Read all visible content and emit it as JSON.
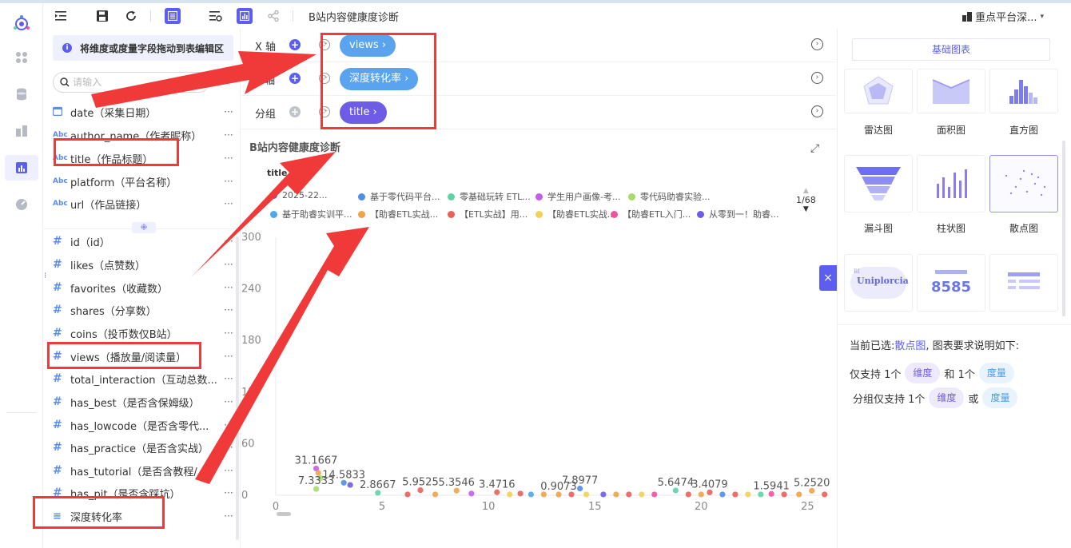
{
  "toolbar": {
    "title": "B站内容健康度诊断",
    "platform": "重点平台深...",
    "icons": [
      "outdent-icon",
      "save-icon",
      "refresh-icon",
      "table-view-icon",
      "filter-settings-icon",
      "chart-view-icon",
      "share-icon"
    ]
  },
  "rail": {
    "icons": [
      "logo-icon",
      "grid-icon",
      "database-icon",
      "dashboard-icon",
      "chart-icon",
      "gauge-icon"
    ]
  },
  "fields_panel": {
    "hint": "将维度或度量字段拖动到表编辑区",
    "search_placeholder": "请输入",
    "dimensions": [
      {
        "type": "date",
        "label": "date（采集日期）"
      },
      {
        "type": "text",
        "label": "author_name（作者昵称）"
      },
      {
        "type": "text",
        "label": "title（作品标题）"
      },
      {
        "type": "text",
        "label": "platform（平台名称）"
      },
      {
        "type": "text",
        "label": "url（作品链接）"
      }
    ],
    "measures": [
      {
        "type": "number",
        "label": "id（id）"
      },
      {
        "type": "number",
        "label": "likes（点赞数）"
      },
      {
        "type": "number",
        "label": "favorites（收藏数）"
      },
      {
        "type": "number",
        "label": "shares（分享数）"
      },
      {
        "type": "number",
        "label": "coins（投币数仅B站）"
      },
      {
        "type": "number",
        "label": "views（播放量/阅读量）"
      },
      {
        "type": "number",
        "label": "total_interaction（互动总数..."
      },
      {
        "type": "number",
        "label": "has_best（是否含保姆级）"
      },
      {
        "type": "number",
        "label": "has_lowcode（是否含零代..."
      },
      {
        "type": "number",
        "label": "has_practice（是否含实战）"
      },
      {
        "type": "number",
        "label": "has_tutorial（是否含教程/..."
      },
      {
        "type": "number",
        "label": "has_pit（是否含踩坑）"
      },
      {
        "type": "calc",
        "label": "深度转化率"
      }
    ],
    "type_badges": {
      "text": "Abc",
      "number": "#",
      "date": "▤",
      "calc": "≡"
    },
    "more": "···"
  },
  "axes": {
    "rows": [
      {
        "label": "X 轴",
        "pill": "views ›",
        "pill_color": "blue"
      },
      {
        "label": "Y 轴",
        "pill": "深度转化率 ›",
        "pill_color": "blue"
      },
      {
        "label": "分组",
        "pill": "title ›",
        "pill_color": "purple"
      }
    ]
  },
  "chart": {
    "title": "B站内容健康度诊断",
    "legend_title": "title",
    "pager": "1/68",
    "legend_items": [
      {
        "label": "2025-22...",
        "color": "#5b5ef0"
      },
      {
        "label": "基于零代码平台...",
        "color": "#4f8de8"
      },
      {
        "label": "零基础玩转 ETL...",
        "color": "#5fd3a6"
      },
      {
        "label": "学生用户画像-考...",
        "color": "#c45de8"
      },
      {
        "label": "零代码助睿实验...",
        "color": "#a6dd6a"
      },
      {
        "label": "基于助睿实训平...",
        "color": "#4fa8e8"
      },
      {
        "label": "【助睿ETL实战...",
        "color": "#f0a24a"
      },
      {
        "label": "【ETL实战】用...",
        "color": "#e8605a"
      },
      {
        "label": "【助睿ETL实战...",
        "color": "#f2d05a"
      },
      {
        "label": "【助睿ETL入门...",
        "color": "#f052a0"
      },
      {
        "label": "从零到一！助睿...",
        "color": "#6e5ce6"
      }
    ]
  },
  "chart_data": {
    "type": "scatter",
    "title": "B站内容健康度诊断",
    "xlabel": "",
    "ylabel": "",
    "xlim": [
      0,
      26
    ],
    "ylim": [
      0,
      300
    ],
    "x_ticks": [
      0,
      5,
      10,
      15,
      20,
      25
    ],
    "y_ticks": [
      0,
      60,
      120,
      180,
      240,
      300
    ],
    "y_tick_labels": [
      "0",
      "60",
      "12",
      "180",
      "240",
      "300"
    ],
    "grid": false,
    "legend_placement": "top",
    "points": [
      {
        "x": 1.9,
        "y": 31.1667,
        "label": "31.1667",
        "color": "#c45de8"
      },
      {
        "x": 2.0,
        "y": 26,
        "color": "#f0a24a"
      },
      {
        "x": 2.1,
        "y": 20,
        "color": "#a6dd6a"
      },
      {
        "x": 1.9,
        "y": 7.3333,
        "label": "7.3333",
        "color": "#a6dd6a"
      },
      {
        "x": 3.2,
        "y": 14.5833,
        "label": "14.5833",
        "color": "#4f8de8"
      },
      {
        "x": 3.5,
        "y": 12,
        "color": "#6e5ce6"
      },
      {
        "x": 4.8,
        "y": 2.8667,
        "label": "2.8667",
        "color": "#5fd3a6"
      },
      {
        "x": 6.8,
        "y": 5.9525,
        "label": "5.9525",
        "color": "#e8605a"
      },
      {
        "x": 8.5,
        "y": 5.3546,
        "label": "5.3546",
        "color": "#f0a24a"
      },
      {
        "x": 10.4,
        "y": 3.4716,
        "label": "3.4716",
        "color": "#e8605a"
      },
      {
        "x": 13.3,
        "y": 0.9073,
        "label": "0.9073",
        "color": "#f0a24a"
      },
      {
        "x": 14.3,
        "y": 7.8977,
        "label": "7.8977",
        "color": "#4f8de8"
      },
      {
        "x": 18.8,
        "y": 5.6474,
        "label": "5.6474",
        "color": "#5fd3a6"
      },
      {
        "x": 20.4,
        "y": 3.4079,
        "label": "3.4079",
        "color": "#e8605a"
      },
      {
        "x": 23.3,
        "y": 1.5941,
        "label": "1.5941",
        "color": "#f052a0"
      },
      {
        "x": 25.2,
        "y": 5.252,
        "label": "5.2520",
        "color": "#f0a24a"
      },
      {
        "x": 6.2,
        "y": 1,
        "color": "#e8605a"
      },
      {
        "x": 7.5,
        "y": 1,
        "color": "#f0a24a"
      },
      {
        "x": 9.2,
        "y": 2,
        "color": "#c45de8"
      },
      {
        "x": 11.0,
        "y": 1,
        "color": "#f2d05a"
      },
      {
        "x": 11.5,
        "y": 2,
        "color": "#e8605a"
      },
      {
        "x": 12.0,
        "y": 1,
        "color": "#4fa8e8"
      },
      {
        "x": 12.6,
        "y": 1,
        "color": "#f0a24a"
      },
      {
        "x": 13.9,
        "y": 1,
        "color": "#e8605a"
      },
      {
        "x": 14.6,
        "y": 1,
        "color": "#f2d05a"
      },
      {
        "x": 15.4,
        "y": 1,
        "color": "#6e5ce6"
      },
      {
        "x": 16.0,
        "y": 1,
        "color": "#f0a24a"
      },
      {
        "x": 16.6,
        "y": 1,
        "color": "#e8605a"
      },
      {
        "x": 17.2,
        "y": 1,
        "color": "#f2d05a"
      },
      {
        "x": 17.8,
        "y": 1,
        "color": "#f052a0"
      },
      {
        "x": 19.4,
        "y": 1,
        "color": "#e8605a"
      },
      {
        "x": 20.0,
        "y": 1,
        "color": "#f0a24a"
      },
      {
        "x": 21.0,
        "y": 1,
        "color": "#4f8de8"
      },
      {
        "x": 21.6,
        "y": 1,
        "color": "#e8605a"
      },
      {
        "x": 22.2,
        "y": 1,
        "color": "#f2d05a"
      },
      {
        "x": 22.8,
        "y": 1,
        "color": "#5fd3a6"
      },
      {
        "x": 23.9,
        "y": 1,
        "color": "#e8605a"
      },
      {
        "x": 24.6,
        "y": 1,
        "color": "#f0a24a"
      },
      {
        "x": 25.8,
        "y": 1,
        "color": "#e8605a"
      }
    ]
  },
  "right_panel": {
    "tab_label": "基础图表",
    "charts": [
      {
        "label": "雷达图",
        "icon": "radar-chart-icon"
      },
      {
        "label": "面积图",
        "icon": "area-chart-icon"
      },
      {
        "label": "直方图",
        "icon": "histogram-icon"
      },
      {
        "label": "漏斗图",
        "icon": "funnel-chart-icon"
      },
      {
        "label": "柱状图",
        "icon": "bar-chart-icon"
      },
      {
        "label": "散点图",
        "icon": "scatter-chart-icon"
      },
      {
        "label": "",
        "icon": "word-cloud-icon"
      },
      {
        "label": "",
        "icon": "number-card-icon"
      },
      {
        "label": "",
        "icon": "table-chart-icon"
      }
    ],
    "word_cloud_text": "Uniplorcia",
    "word_cloud_small": "BI",
    "number_card_value": "8585",
    "requirement": {
      "prefix": "当前已选: ",
      "selected": "散点图",
      "suffix": ", 图表要求说明如下:",
      "line1_a": "仅支持 1个",
      "line1_dim": "维度",
      "line1_b": "和 1个",
      "line1_mea": "度量",
      "line2_a": "分组仅支持 1个",
      "line2_dim": "维度",
      "line2_b": "或",
      "line2_mea": "度量"
    },
    "close_icon": "×"
  }
}
